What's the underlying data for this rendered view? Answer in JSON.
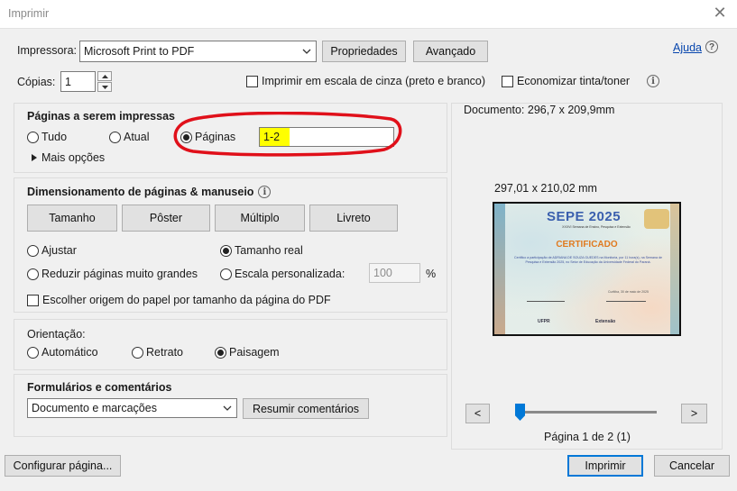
{
  "window": {
    "title": "Imprimir",
    "close_icon": "close-icon"
  },
  "printer": {
    "label": "Impressora:",
    "value": "Microsoft Print to PDF",
    "properties_button": "Propriedades",
    "advanced_button": "Avançado",
    "help_link": "Ajuda",
    "help_icon": "question-icon"
  },
  "copies": {
    "label": "Cópias:",
    "value": "1",
    "grayscale_label": "Imprimir em escala de cinza (preto e branco)",
    "grayscale_checked": false,
    "save_ink_label": "Economizar tinta/toner",
    "save_ink_checked": false
  },
  "pages": {
    "title": "Páginas a serem impressas",
    "all_label": "Tudo",
    "current_label": "Atual",
    "pages_label": "Páginas",
    "selected": "pages",
    "pages_value": "1-2",
    "more_options": "Mais opções",
    "highlight_color": "#ffff00",
    "annotation_color": "#e0101a"
  },
  "sizing": {
    "title": "Dimensionamento de páginas & manuseio",
    "tabs": [
      "Tamanho",
      "Pôster",
      "Múltiplo",
      "Livreto"
    ],
    "fit_label": "Ajustar",
    "actual_label": "Tamanho real",
    "shrink_label": "Reduzir páginas muito grandes",
    "custom_label": "Escala personalizada:",
    "custom_value": "100",
    "percent": "%",
    "selected": "actual",
    "paper_source_label": "Escolher origem do papel por tamanho da página do PDF",
    "paper_source_checked": false
  },
  "orientation": {
    "title": "Orientação:",
    "auto_label": "Automático",
    "portrait_label": "Retrato",
    "landscape_label": "Paisagem",
    "selected": "landscape"
  },
  "forms": {
    "title": "Formulários e comentários",
    "value": "Documento e marcações",
    "summarize_button": "Resumir comentários"
  },
  "preview": {
    "document_label": "Documento: 296,7 x 209,9mm",
    "page_size_label": "297,01 x 210,02 mm",
    "prev_button": "<",
    "next_button": ">",
    "page_indicator": "Página 1 de 2 (1)",
    "slider_fraction": 0.0,
    "thumbnail": {
      "event_title": "SEPE 2025",
      "event_subtitle": "XXXVI Semana de Ensino, Pesquisa e Extensão",
      "heading": "CERTIFICADO",
      "body": "Certifico a participação de ADRIANA DE SOUZA GUEDES na Monitoria, por 11 hora(s), na Semana de Pesquisa e Extensão 2025, no Setor de Educação da Universidade Federal do Paraná.",
      "date_line": "Curitiba, 30 de maio de 2025",
      "org_left": "UFPR",
      "org_right": "Extensão"
    }
  },
  "footer": {
    "page_setup_button": "Configurar página...",
    "print_button": "Imprimir",
    "cancel_button": "Cancelar"
  },
  "colors": {
    "accent": "#0078d7",
    "highlight": "#ffff00",
    "annotation": "#e0101a"
  }
}
